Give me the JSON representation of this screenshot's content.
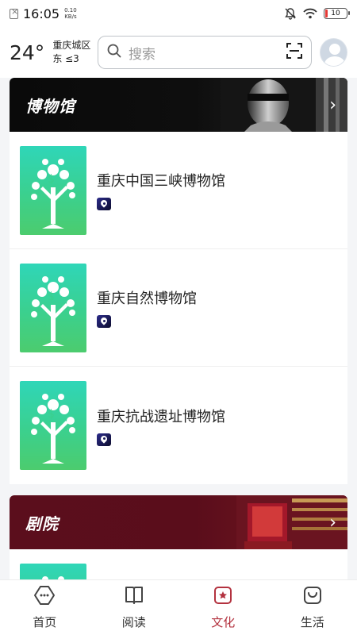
{
  "status": {
    "time": "16:05",
    "speed_value": "0.10",
    "speed_unit": "KB/s",
    "battery": "10",
    "battery_color": "#e53935"
  },
  "header": {
    "temperature": "24°",
    "city": "重庆城区",
    "wind": "东 ≤3",
    "search_placeholder": "搜索"
  },
  "sections": [
    {
      "title": "博物馆",
      "items": [
        {
          "name": "重庆中国三峡博物馆"
        },
        {
          "name": "重庆自然博物馆"
        },
        {
          "name": "重庆抗战遗址博物馆"
        }
      ]
    },
    {
      "title": "剧院"
    }
  ],
  "tabs": [
    {
      "label": "首页",
      "icon": "home-icon"
    },
    {
      "label": "阅读",
      "icon": "book-icon"
    },
    {
      "label": "文化",
      "icon": "culture-icon",
      "active": true
    },
    {
      "label": "生活",
      "icon": "life-bag-icon"
    }
  ],
  "colors": {
    "accent": "#b3323f",
    "thumb_green": "#3bd08e",
    "theatre_banner": "#5b0e1c"
  }
}
